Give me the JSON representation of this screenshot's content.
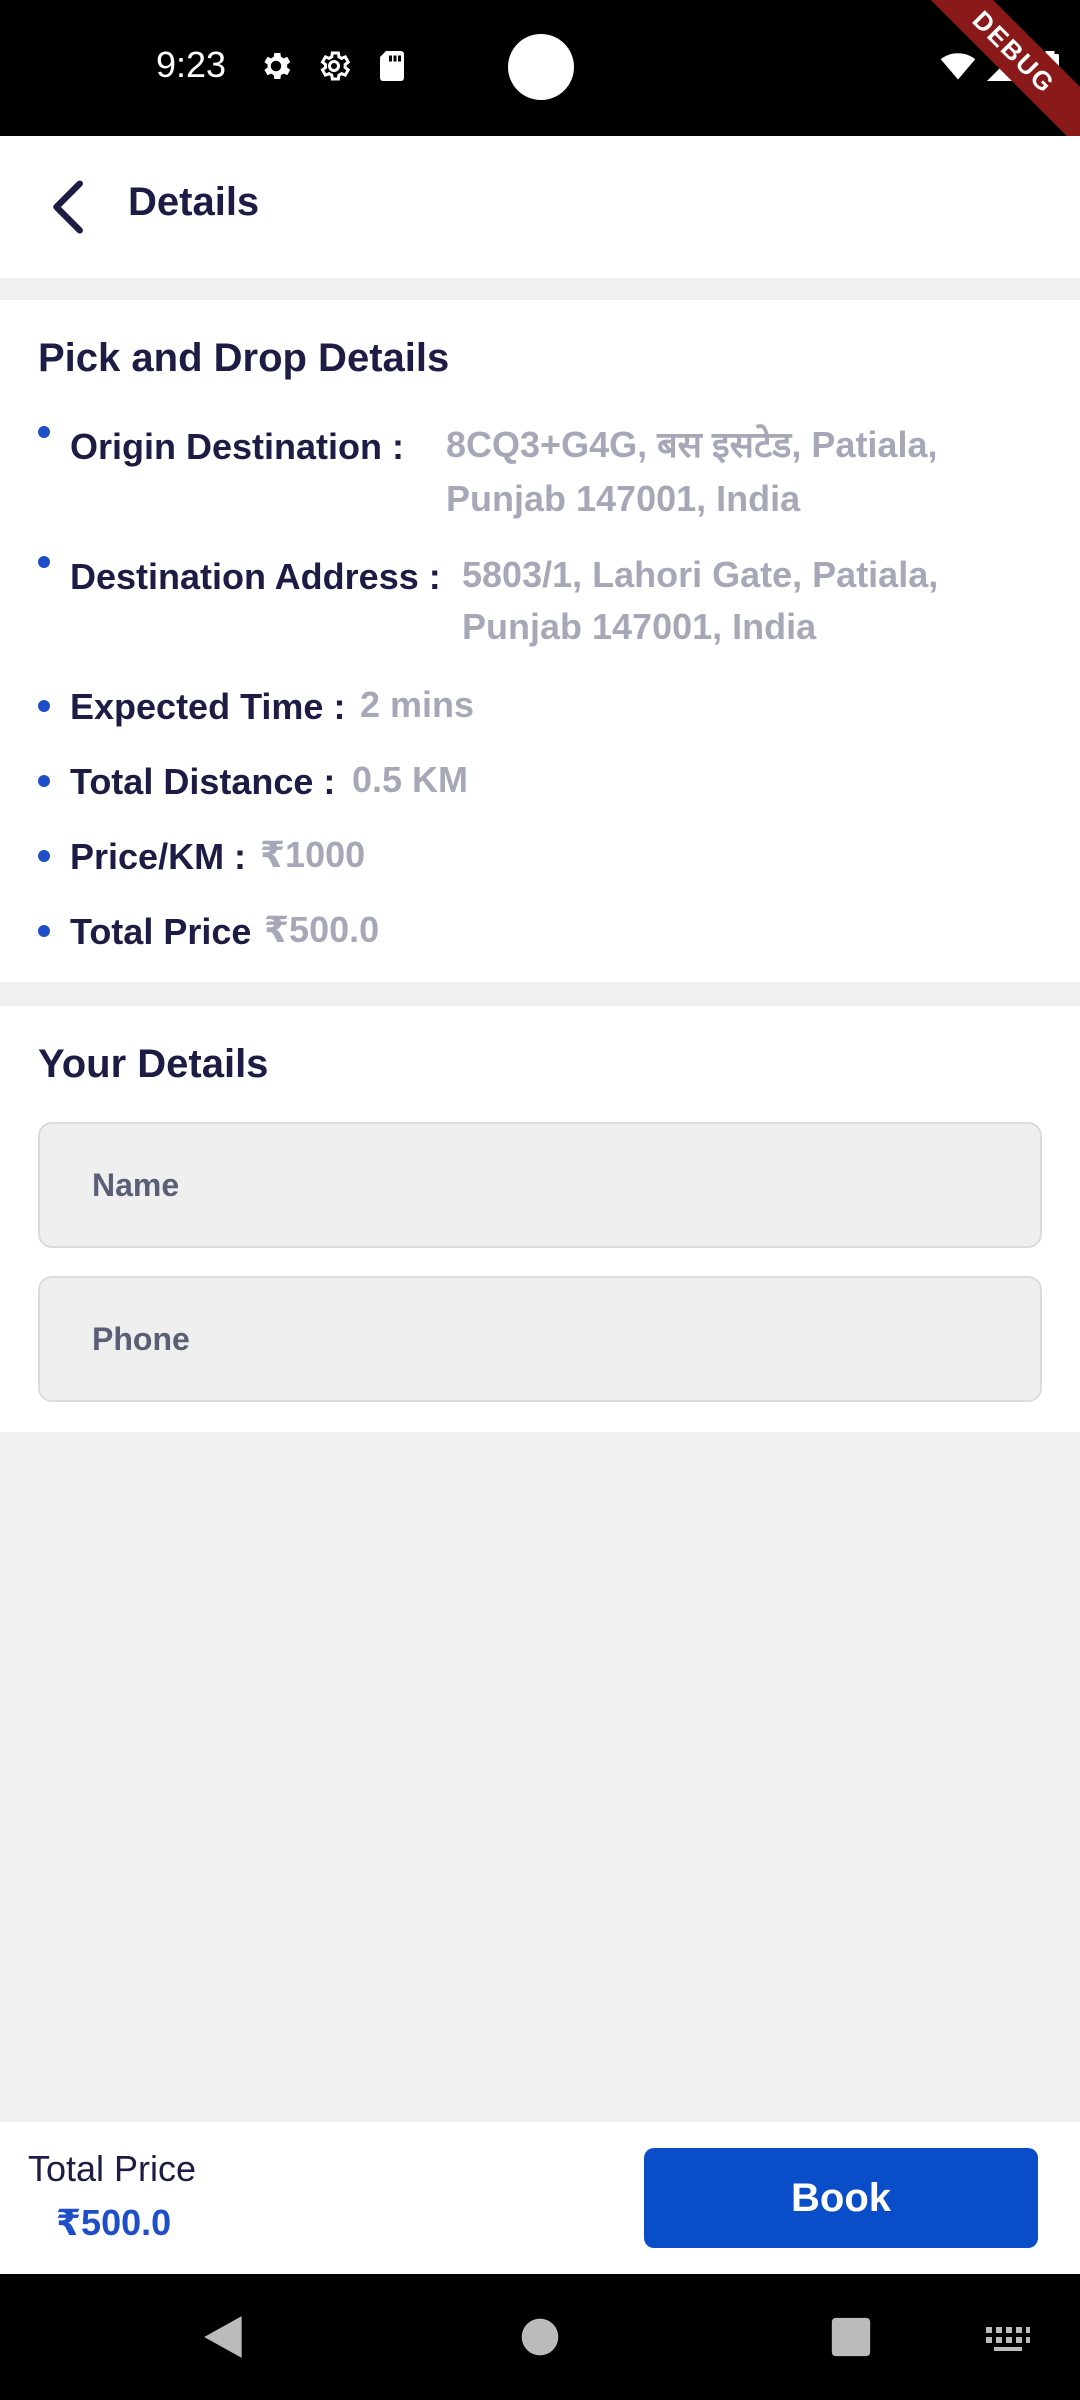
{
  "status_bar": {
    "time": "9:23",
    "icons": [
      "settings-icon",
      "settings-outline-icon",
      "sd-card-icon",
      "wifi-icon",
      "signal-icon",
      "battery-icon"
    ],
    "debug_banner": "DEBUG"
  },
  "app_bar": {
    "title": "Details",
    "back_icon": "chevron-left-icon"
  },
  "pick_drop": {
    "title": "Pick and Drop Details",
    "rows": [
      {
        "label": "Origin Destination :",
        "value_line1": "8CQ3+G4G, बस इसटेड, Patiala,",
        "value_line2": "Punjab 147001, India"
      },
      {
        "label": "Destination Address :",
        "value_line1": "5803/1, Lahori Gate, Patiala,",
        "value_line2": "Punjab 147001, India"
      },
      {
        "label": "Expected Time :",
        "value": "2 mins"
      },
      {
        "label": "Total Distance :",
        "value": "0.5 KM"
      },
      {
        "label": "Price/KM :",
        "value": "₹1000"
      },
      {
        "label": "Total Price",
        "value": "₹500.0"
      }
    ]
  },
  "your_details": {
    "title": "Your Details",
    "name_placeholder": "Name",
    "phone_placeholder": "Phone"
  },
  "bottom_bar": {
    "total_label": "Total Price",
    "total_value": "₹500.0",
    "book_label": "Book"
  },
  "nav_bar": {
    "icons": [
      "back-triangle-icon",
      "home-circle-icon",
      "recents-square-icon",
      "keyboard-icon"
    ]
  },
  "colors": {
    "accent": "#0a4dc8",
    "title_text": "#1c1c44",
    "value_text": "#a6a8b8",
    "background": "#f0f0f0"
  }
}
